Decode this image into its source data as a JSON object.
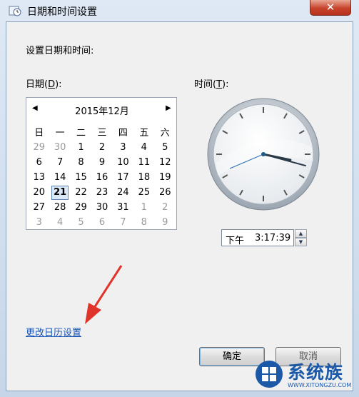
{
  "window": {
    "title": "日期和时间设置"
  },
  "heading": "设置日期和时间:",
  "date_label": {
    "text": "日期(",
    "key": "D",
    "suffix": "):"
  },
  "time_label": {
    "text": "时间(",
    "key": "T",
    "suffix": "):"
  },
  "calendar": {
    "month_label": "2015年12月",
    "prev_glyph": "◀",
    "next_glyph": "▶",
    "weekdays": [
      "日",
      "一",
      "二",
      "三",
      "四",
      "五",
      "六"
    ],
    "selected_day": "21",
    "weeks": [
      [
        "29",
        "30",
        "1",
        "2",
        "3",
        "4",
        "5"
      ],
      [
        "6",
        "7",
        "8",
        "9",
        "10",
        "11",
        "12"
      ],
      [
        "13",
        "14",
        "15",
        "16",
        "17",
        "18",
        "19"
      ],
      [
        "20",
        "21",
        "22",
        "23",
        "24",
        "25",
        "26"
      ],
      [
        "27",
        "28",
        "29",
        "30",
        "31",
        "1",
        "2"
      ],
      [
        "3",
        "4",
        "5",
        "6",
        "7",
        "8",
        "9"
      ]
    ]
  },
  "time": {
    "ampm": "下午",
    "value": "3:17:39"
  },
  "change_calendar_link": "更改日历设置",
  "buttons": {
    "ok": "确定",
    "cancel": "取消"
  },
  "watermark": {
    "name": "系统族",
    "url": "WWW.XITONGZU.COM"
  },
  "colors": {
    "link": "#1a55b5",
    "close_button": "#c7432b",
    "arrow": "#e0342b",
    "watermark": "#1b58a8"
  }
}
